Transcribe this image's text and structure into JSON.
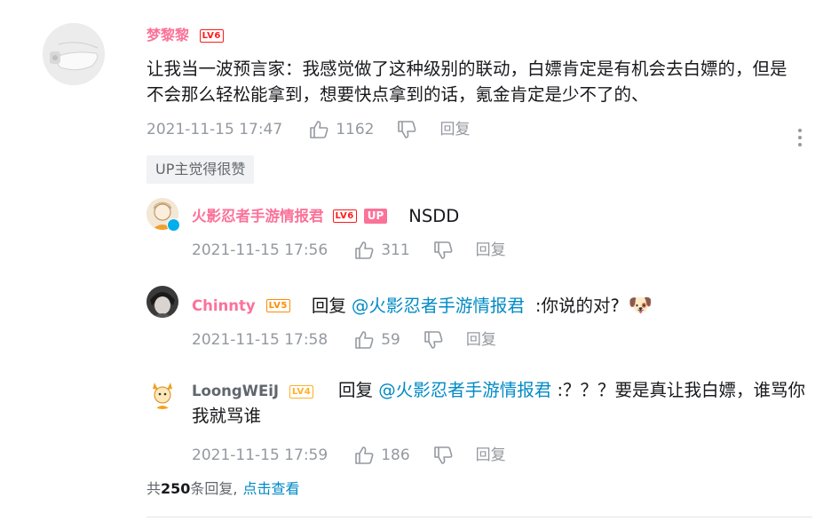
{
  "main_comment": {
    "username": "梦黎黎",
    "level": "LV6",
    "text": "让我当一波预言家：我感觉做了这种级别的联动，白嫖肯定是有机会去白嫖的，但是不会那么轻松能拿到，想要快点拿到的话，氪金肯定是少不了的、",
    "timestamp": "2021-11-15 17:47",
    "likes": "1162",
    "reply_label": "回复",
    "up_liked_badge": "UP主觉得很赞"
  },
  "replies": [
    {
      "username": "火影忍者手游情报君",
      "level": "LV6",
      "up_badge": "UP",
      "text": "NSDD",
      "timestamp": "2021-11-15 17:56",
      "likes": "311",
      "reply_label": "回复"
    },
    {
      "username": "Chinnty",
      "level": "LV5",
      "reply_prefix": "回复",
      "mention": "@火影忍者手游情报君",
      "text": ":你说的对?",
      "emoji": "🐶",
      "timestamp": "2021-11-15 17:58",
      "likes": "59",
      "reply_label": "回复"
    },
    {
      "username": "LoongWEiJ",
      "level": "LV4",
      "reply_prefix": "回复",
      "mention": "@火影忍者手游情报君",
      "text": ":？？？要是真让我白嫖，谁骂你我就骂谁",
      "timestamp": "2021-11-15 17:59",
      "likes": "186",
      "reply_label": "回复"
    }
  ],
  "footer": {
    "total_prefix": "共",
    "total_count": "250",
    "total_suffix": "条回复,",
    "view_link": "点击查看"
  },
  "colors": {
    "username_pink": "#fb7299",
    "link_blue": "#008ac5",
    "meta_gray": "#9499a0",
    "lv6": "#ff1a1a",
    "lv5": "#ff8c00",
    "lv4": "#ffb027"
  },
  "icons": [
    "thumbs-up-icon",
    "thumbs-down-icon",
    "more-icon",
    "verified-icon"
  ]
}
